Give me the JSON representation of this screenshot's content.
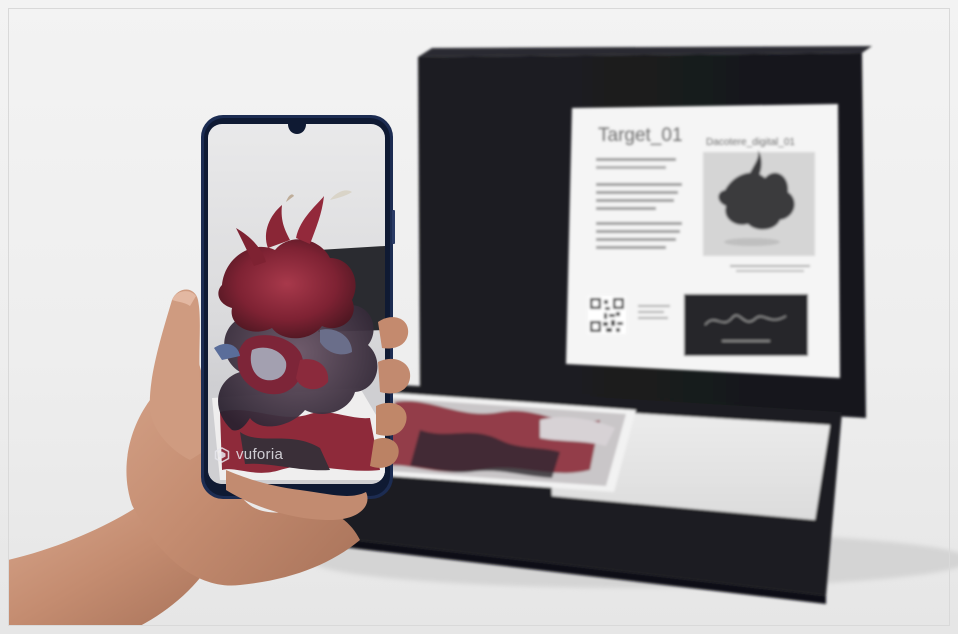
{
  "card": {
    "title": "Target_01",
    "artwork_title": "Dacotere_digital_01"
  },
  "phone": {
    "watermark": "vuforia"
  },
  "icons": [
    "qr-code",
    "vuforia-logo"
  ],
  "colors": {
    "background": "#efefef",
    "box": "#1b1c1f",
    "sculpture_red": "#8b2738",
    "sculpture_dark": "#3a2430",
    "phone_frame": "#1f2f55",
    "skin": "#c69275"
  }
}
